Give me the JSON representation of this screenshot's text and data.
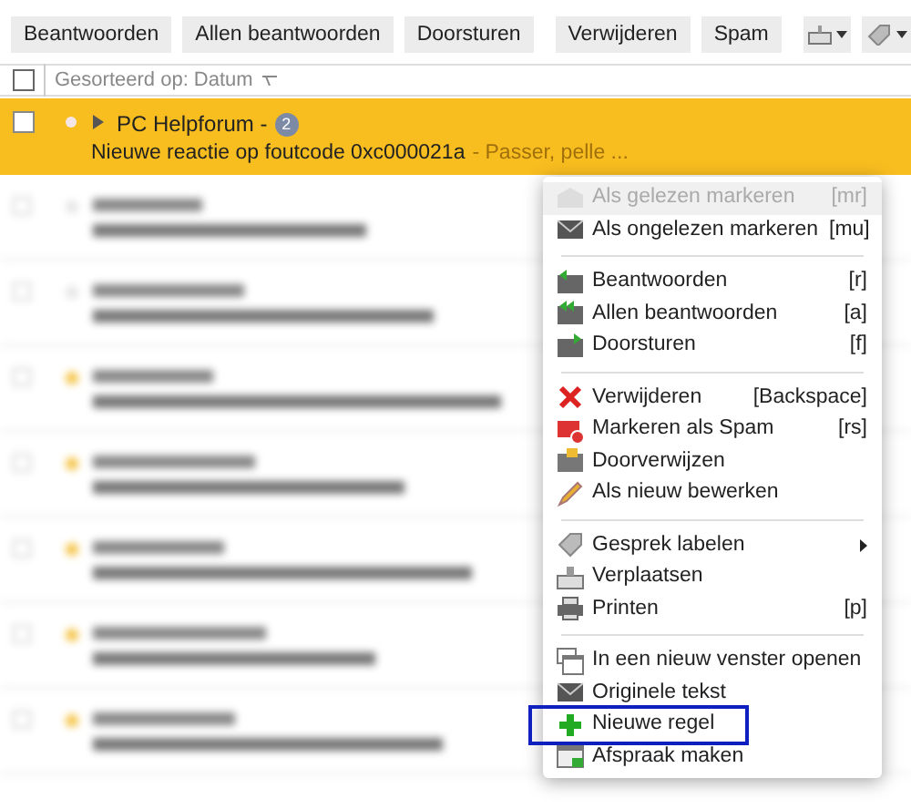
{
  "toolbar": {
    "buttons": [
      "Beantwoorden",
      "Allen beantwoorden",
      "Doorsturen",
      "Verwijderen",
      "Spam"
    ]
  },
  "list_header": {
    "sort_label": "Gesorteerd op: Datum",
    "checked": false
  },
  "selected_message": {
    "sender": "PC Helpforum -",
    "count": "2",
    "subject": "Nieuwe reactie op foutcode 0xc000021a",
    "preview": "- Passer, pelle ...",
    "checked": false,
    "selected": true
  },
  "blurred_rows": [
    {
      "starred": false
    },
    {
      "starred": false
    },
    {
      "starred": true
    },
    {
      "starred": true
    },
    {
      "starred": true
    },
    {
      "starred": true
    },
    {
      "starred": true
    }
  ],
  "context_menu": {
    "groups": [
      [
        {
          "label": "Als gelezen markeren",
          "shortcut": "[mr]",
          "disabled": true
        },
        {
          "label": "Als ongelezen markeren",
          "shortcut": "[mu]",
          "disabled": false
        }
      ],
      [
        {
          "label": "Beantwoorden",
          "shortcut": "[r]",
          "disabled": false
        },
        {
          "label": "Allen beantwoorden",
          "shortcut": "[a]",
          "disabled": false
        },
        {
          "label": "Doorsturen",
          "shortcut": "[f]",
          "disabled": false
        }
      ],
      [
        {
          "label": "Verwijderen",
          "shortcut": "[Backspace]",
          "disabled": false
        },
        {
          "label": "Markeren als Spam",
          "shortcut": "[rs]",
          "disabled": false
        },
        {
          "label": "Doorverwijzen",
          "disabled": false
        },
        {
          "label": "Als nieuw bewerken",
          "disabled": false
        }
      ],
      [
        {
          "label": "Gesprek labelen",
          "submenu": true,
          "disabled": false
        },
        {
          "label": "Verplaatsen",
          "disabled": false
        },
        {
          "label": "Printen",
          "shortcut": "[p]",
          "disabled": false
        }
      ],
      [
        {
          "label": "In een nieuw venster openen",
          "disabled": false
        },
        {
          "label": "Originele tekst",
          "disabled": false
        },
        {
          "label": "Nieuwe regel",
          "disabled": false,
          "highlighted": true
        },
        {
          "label": "Afspraak maken",
          "disabled": false
        }
      ]
    ]
  }
}
